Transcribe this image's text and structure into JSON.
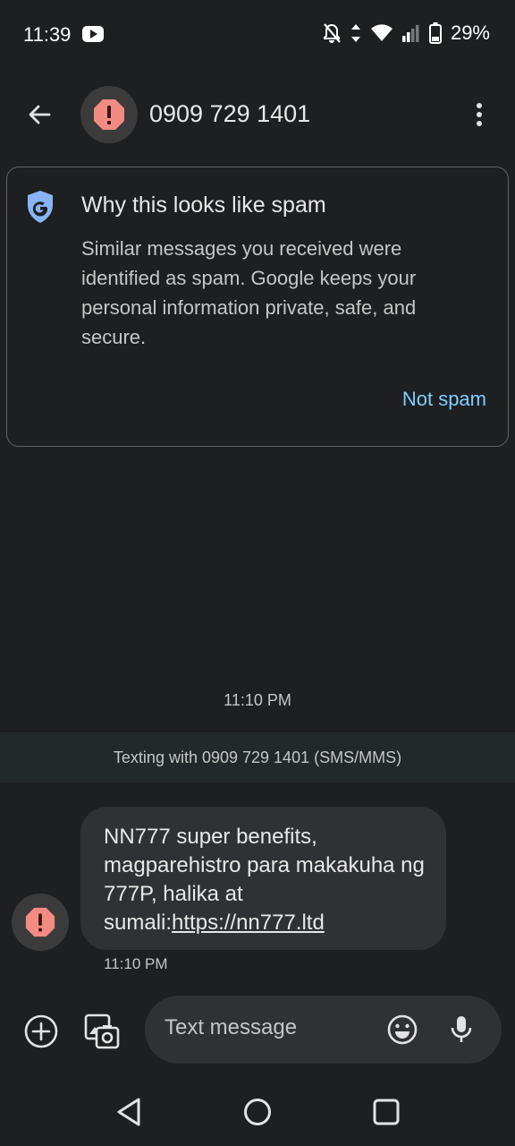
{
  "status_bar": {
    "time": "11:39",
    "battery": "29%",
    "icons": [
      "youtube-icon",
      "notifications-off-icon",
      "data-arrows-icon",
      "wifi-icon",
      "signal-icon",
      "battery-icon"
    ]
  },
  "header": {
    "contact": "0909 729 1401",
    "icons": [
      "back-arrow-icon",
      "spam-warning-icon",
      "more-vert-icon"
    ]
  },
  "spam_card": {
    "title": "Why this looks like spam",
    "body": "Similar messages you received were identified as spam. Google keeps your personal information private, safe, and secure.",
    "action": "Not spam",
    "icon": "google-shield-icon"
  },
  "conversation": {
    "timestamp": "11:10 PM",
    "banner": "Texting with 0909 729 1401 (SMS/MMS)",
    "messages": [
      {
        "text": "NN777 super benefits, magparehistro para makakuha ng 777P, halika at sumali:",
        "link": "https://nn777.ltd",
        "time": "11:10 PM"
      }
    ]
  },
  "composer": {
    "placeholder": "Text message",
    "icons": [
      "add-icon",
      "gallery-icon",
      "emoji-icon",
      "mic-icon"
    ]
  },
  "colors": {
    "background": "#1e1f21",
    "bubble": "#303134",
    "accent": "#7fcfff",
    "warning": "#f28b82"
  }
}
